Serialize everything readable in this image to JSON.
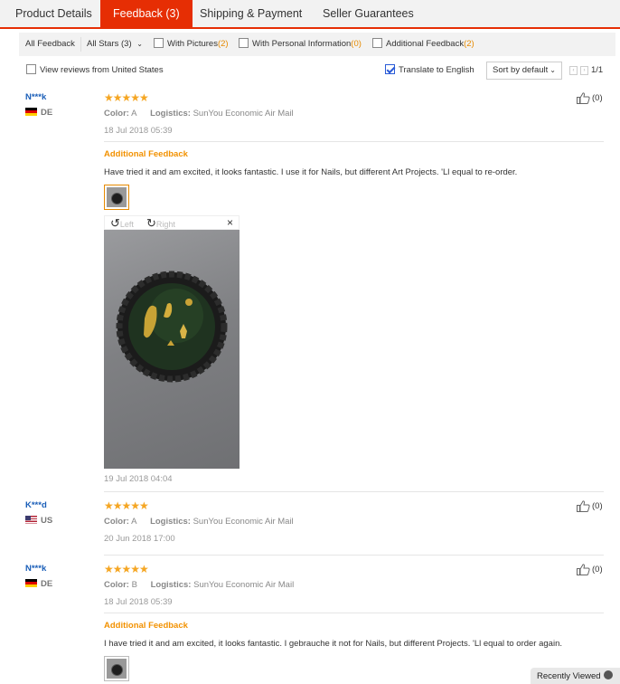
{
  "tabs": [
    "Product Details",
    "Feedback (3)",
    "Shipping & Payment",
    "Seller Guarantees"
  ],
  "filters": {
    "all_feedback": "All Feedback",
    "all_stars": "All Stars (3)",
    "with_pictures": "With Pictures",
    "with_pictures_count": "(2)",
    "with_personal": "With Personal Information",
    "with_personal_count": "(0)",
    "additional": "Additional Feedback",
    "additional_count": "(2)"
  },
  "options": {
    "view_us": "View reviews from United States",
    "translate": "Translate to English",
    "translate_checked": true,
    "sort": "Sort by default",
    "page": "1/1"
  },
  "reviews": [
    {
      "user": "N***k",
      "country": "DE",
      "stars": "★★★★★",
      "color_label": "Color:",
      "color": "A",
      "logistics_label": "Logistics:",
      "logistics": "SunYou Economic Air Mail",
      "date": "18 Jul 2018 05:39",
      "helpful": "(0)",
      "additional_title": "Additional Feedback",
      "additional_text": "Have tried it and am excited, it looks fantastic. I use it for Nails, but different Art Projects. 'Ll equal to re-order.",
      "additional_date": "19 Jul 2018 04:04",
      "viewer_left": "Left",
      "viewer_right": "Right",
      "viewer_close": "×"
    },
    {
      "user": "K***d",
      "country": "US",
      "stars": "★★★★★",
      "color_label": "Color:",
      "color": "A",
      "logistics_label": "Logistics:",
      "logistics": "SunYou Economic Air Mail",
      "date": "20 Jun 2018 17:00",
      "helpful": "(0)"
    },
    {
      "user": "N***k",
      "country": "DE",
      "stars": "★★★★★",
      "color_label": "Color:",
      "color": "B",
      "logistics_label": "Logistics:",
      "logistics": "SunYou Economic Air Mail",
      "date": "18 Jul 2018 05:39",
      "helpful": "(0)",
      "additional_title": "Additional Feedback",
      "additional_text": "I have tried it and am excited, it looks fantastic. I gebrauche it not for Nails, but different Projects. 'Ll equal to order again."
    }
  ],
  "recently_viewed": "Recently Viewed",
  "colors": {
    "accent": "#e62e04",
    "link": "#1a5eb8",
    "stars": "#f5a623",
    "additional": "#f29100"
  }
}
